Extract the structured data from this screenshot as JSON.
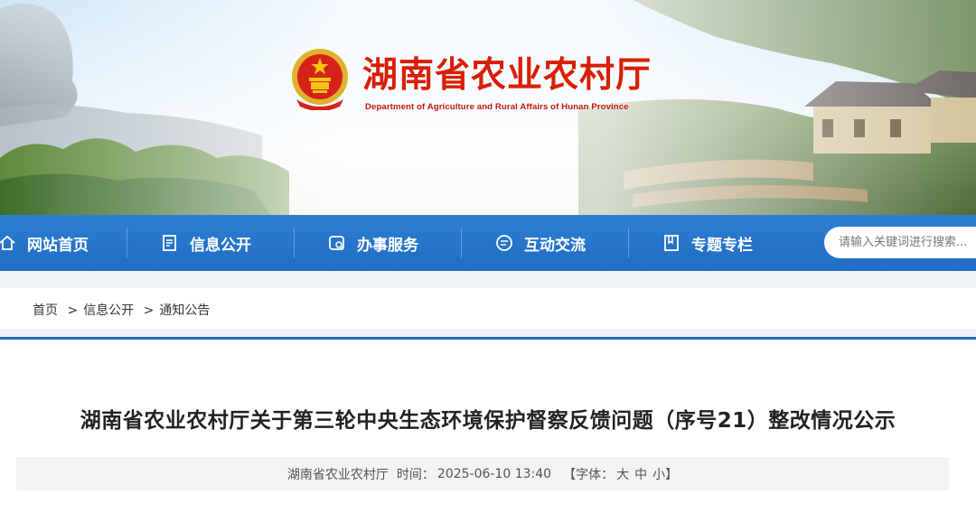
{
  "header": {
    "title": "湖南省农业农村厅",
    "subtitle": "Department of Agriculture and Rural Affairs of Hunan Province"
  },
  "nav": {
    "items": [
      {
        "label": "网站首页",
        "icon": "home-icon"
      },
      {
        "label": "信息公开",
        "icon": "document-icon"
      },
      {
        "label": "办事服务",
        "icon": "service-icon"
      },
      {
        "label": "互动交流",
        "icon": "chat-icon"
      },
      {
        "label": "专题专栏",
        "icon": "bookmark-icon"
      }
    ],
    "search_placeholder": "请输入关键词进行搜索..."
  },
  "breadcrumb": {
    "items": [
      "首页",
      "信息公开",
      "通知公告"
    ],
    "separator": ">"
  },
  "article": {
    "title": "湖南省农业农村厅关于第三轮中央生态环境保护督察反馈问题（序号21）整改情况公示",
    "source": "湖南省农业农村厅",
    "time_label": "时间：",
    "time": "2025-06-10 13:40",
    "font_label": "【字体：",
    "font_large": "大",
    "font_medium": "中",
    "font_small": "小】"
  },
  "colors": {
    "brand_red": "#d81e06",
    "nav_blue": "#1f6dc4"
  }
}
